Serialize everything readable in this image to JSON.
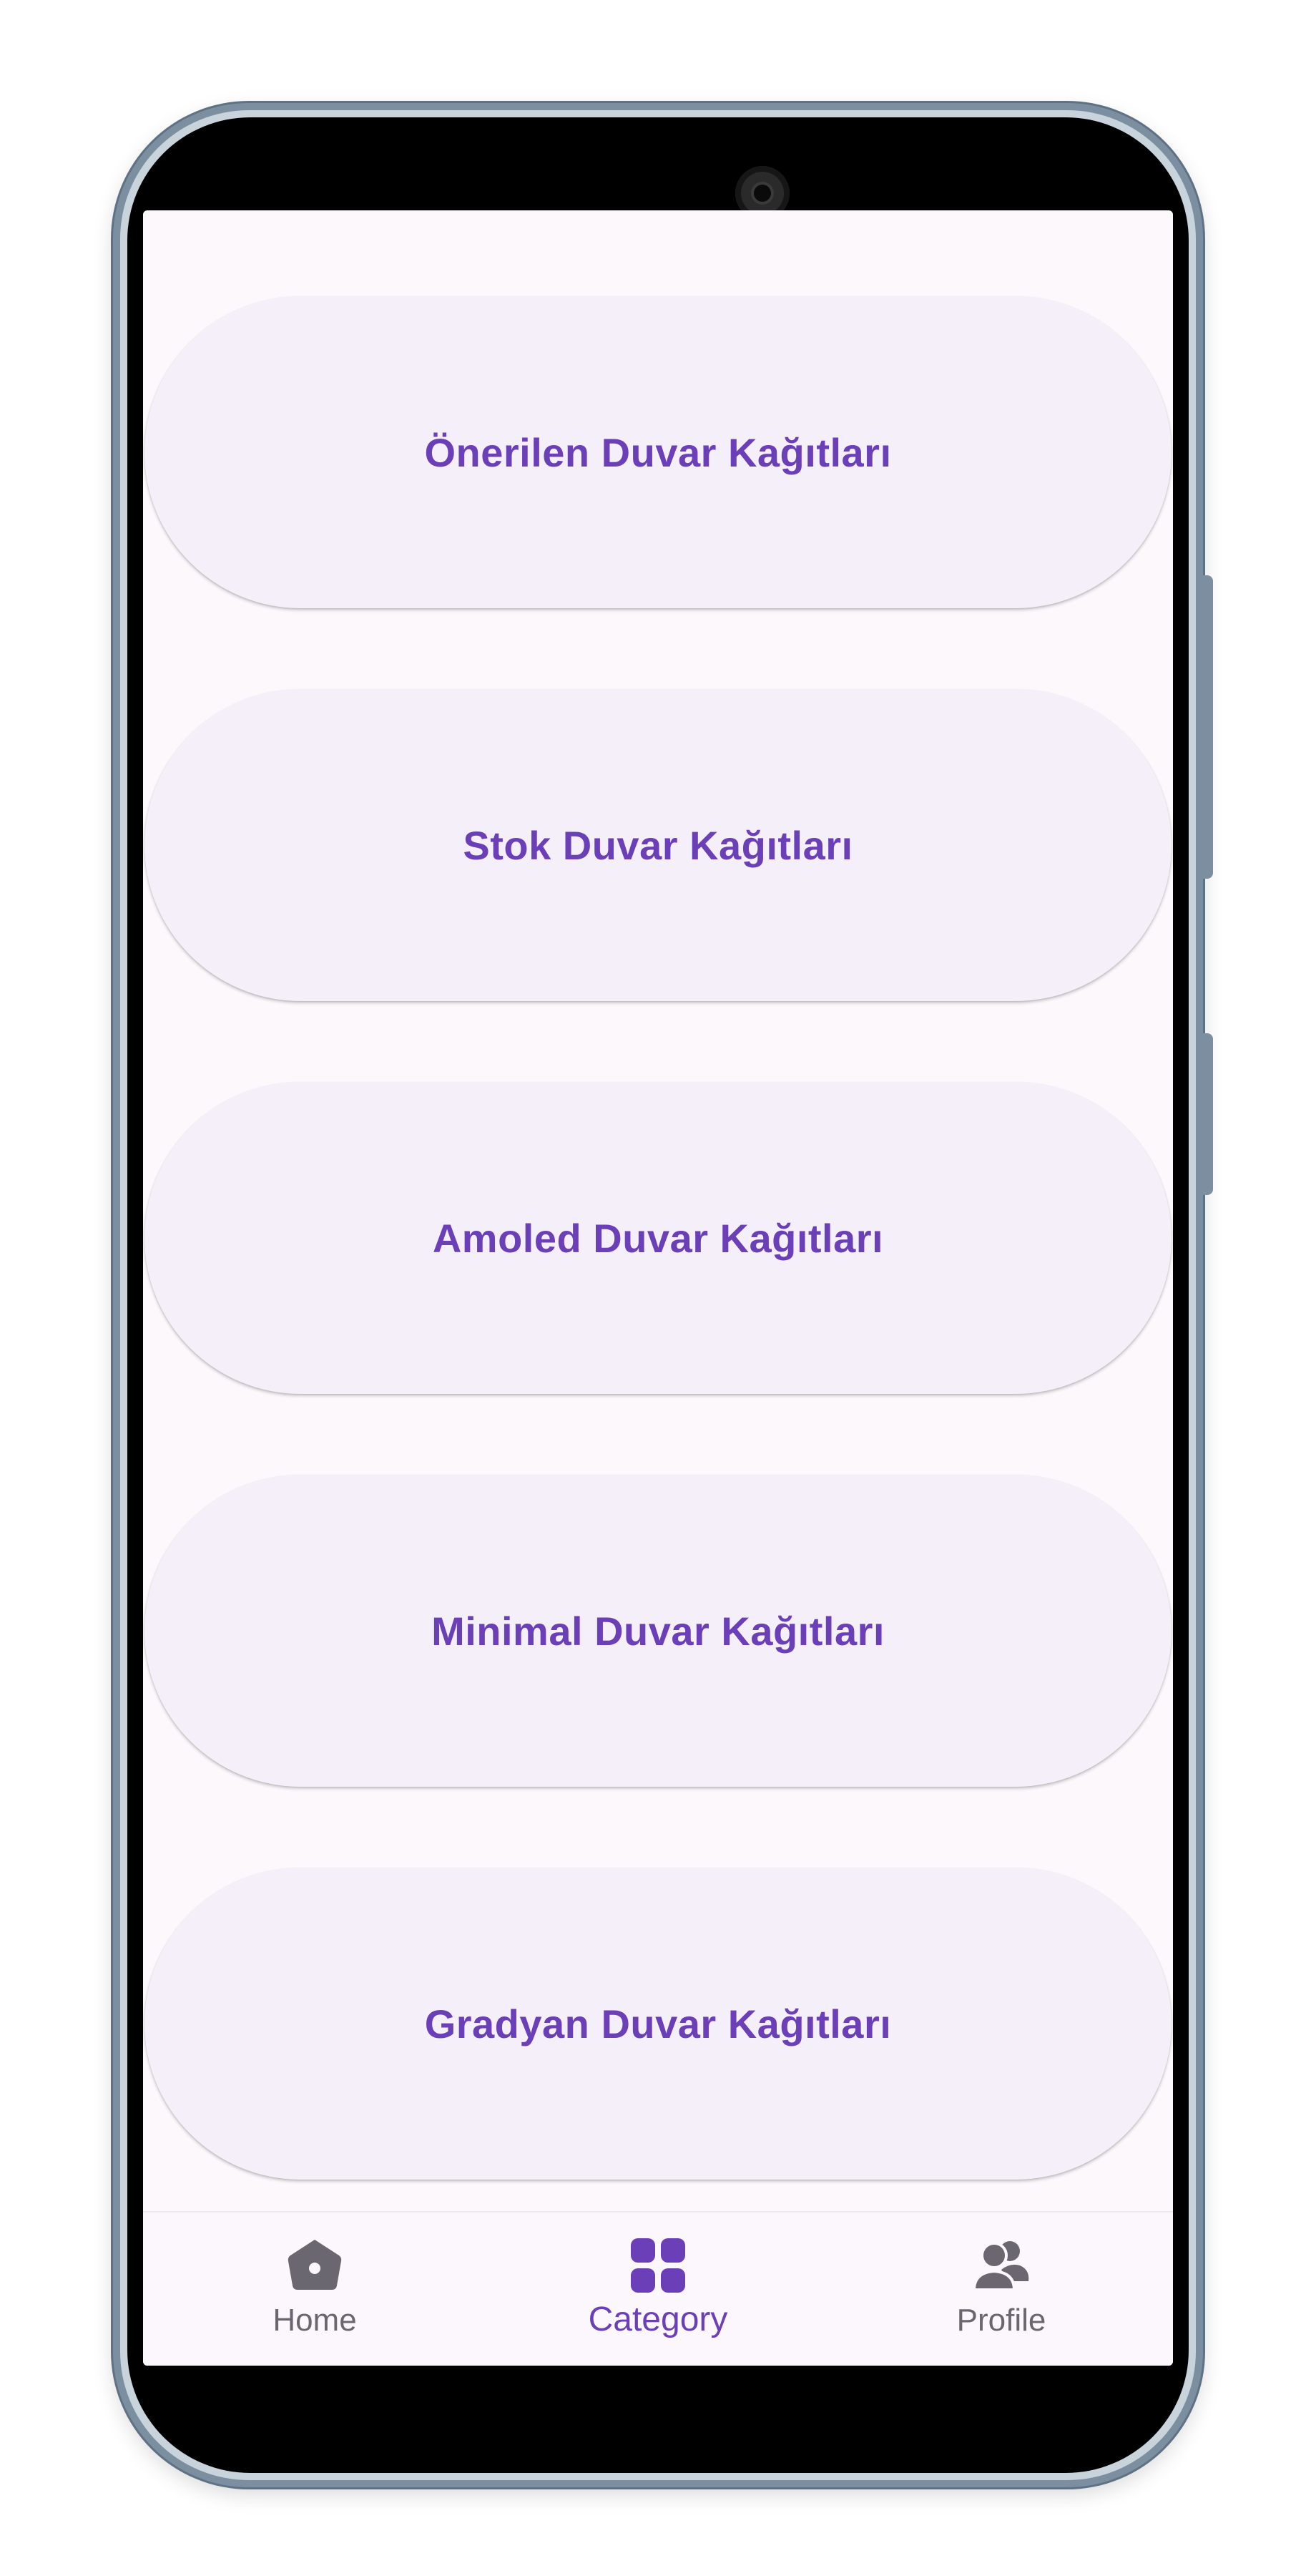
{
  "categories": [
    {
      "label": "Önerilen Duvar Kağıtları"
    },
    {
      "label": "Stok Duvar Kağıtları"
    },
    {
      "label": "Amoled Duvar Kağıtları"
    },
    {
      "label": "Minimal Duvar Kağıtları"
    },
    {
      "label": "Gradyan Duvar Kağıtları"
    }
  ],
  "bottom_nav": {
    "items": [
      {
        "label": "Home",
        "icon": "home-icon",
        "active": false
      },
      {
        "label": "Category",
        "icon": "grid-icon",
        "active": true
      },
      {
        "label": "Profile",
        "icon": "people-icon",
        "active": false
      }
    ]
  },
  "colors": {
    "accent": "#6a3fb8",
    "card_bg": "#f4eff9",
    "screen_bg": "#fdf8fc",
    "inactive_icon": "#6b6770"
  }
}
